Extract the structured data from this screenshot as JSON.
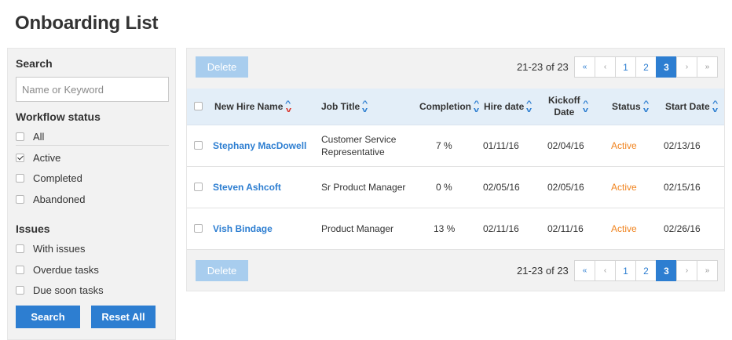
{
  "page_title": "Onboarding List",
  "sidebar": {
    "search_heading": "Search",
    "search_placeholder": "Name or Keyword",
    "workflow_heading": "Workflow status",
    "workflow_options": [
      {
        "label": "All",
        "checked": false
      },
      {
        "label": "Active",
        "checked": true
      },
      {
        "label": "Completed",
        "checked": false
      },
      {
        "label": "Abandoned",
        "checked": false
      }
    ],
    "issues_heading": "Issues",
    "issues_options": [
      {
        "label": "With issues",
        "checked": false
      },
      {
        "label": "Overdue tasks",
        "checked": false
      },
      {
        "label": "Due soon tasks",
        "checked": false
      }
    ],
    "search_button": "Search",
    "reset_button": "Reset All"
  },
  "toolbar": {
    "delete_label": "Delete",
    "range_text": "21-23 of 23",
    "pager": {
      "first": "«",
      "prev": "‹",
      "pages": [
        "1",
        "2",
        "3"
      ],
      "active_page": "3",
      "next": "›",
      "last": "»"
    }
  },
  "table": {
    "columns": {
      "name": "New Hire Name",
      "job": "Job Title",
      "completion": "Completion",
      "hire": "Hire date",
      "kickoff_line1": "Kickoff",
      "kickoff_line2": "Date",
      "status": "Status",
      "start": "Start Date"
    },
    "rows": [
      {
        "name": "Stephany MacDowell",
        "job_line1": "Customer Service",
        "job_line2": "Representative",
        "completion": "7 %",
        "hire": "01/11/16",
        "kickoff": "02/04/16",
        "status": "Active",
        "start": "02/13/16"
      },
      {
        "name": "Steven Ashcoft",
        "job_line1": "Sr Product Manager",
        "job_line2": "",
        "completion": "0 %",
        "hire": "02/05/16",
        "kickoff": "02/05/16",
        "status": "Active",
        "start": "02/15/16"
      },
      {
        "name": "Vish Bindage",
        "job_line1": "Product Manager",
        "job_line2": "",
        "completion": "13 %",
        "hire": "02/11/16",
        "kickoff": "02/11/16",
        "status": "Active",
        "start": "02/26/16"
      }
    ]
  },
  "colors": {
    "accent": "#2d7ed1",
    "status_active": "#f0831e",
    "sort_desc": "#d9342b",
    "delete_disabled": "#a8cdee",
    "header_bg": "#e3eef8"
  }
}
